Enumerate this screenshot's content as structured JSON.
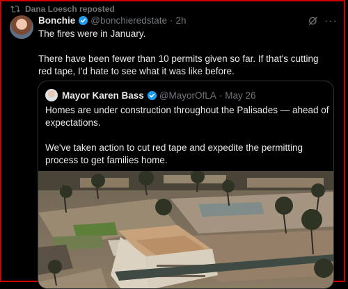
{
  "repost": {
    "label": "Dana Loesch reposted"
  },
  "tweet": {
    "author_name": "Bonchie",
    "handle": "@bonchieredstate",
    "separator": "·",
    "time": "2h",
    "more": "···",
    "paragraphs": [
      "The fires were in January.",
      "There have been fewer than 10 permits given so far. If that's cutting red tape, I'd hate to see what it was like before."
    ]
  },
  "quote": {
    "author_name": "Mayor Karen Bass",
    "handle": "@MayorOfLA",
    "separator": "·",
    "date": "May 26",
    "paragraphs": [
      "Homes are under construction throughout the Palisades — ahead of expectations.",
      "We've taken action to cut red tape and expedite the permitting process to get families home."
    ]
  },
  "colors": {
    "accent": "#1d9bf0",
    "muted": "#71767b",
    "text": "#e7e9ea",
    "background": "#000000"
  },
  "icons": [
    "repost-icon",
    "verified-badge-icon",
    "grok-icon",
    "more-icon"
  ]
}
